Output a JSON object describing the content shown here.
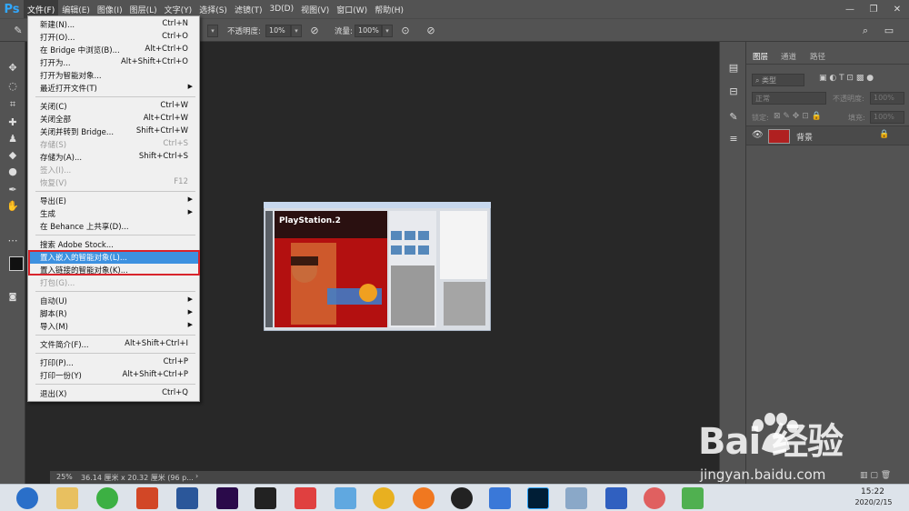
{
  "app": {
    "logo": "Ps"
  },
  "menubar": {
    "items": [
      "文件(F)",
      "编辑(E)",
      "图像(I)",
      "图层(L)",
      "文字(Y)",
      "选择(S)",
      "滤镜(T)",
      "3D(D)",
      "视图(V)",
      "窗口(W)",
      "帮助(H)"
    ]
  },
  "window_controls": {
    "minimize": "—",
    "restore": "❐",
    "close": "✕"
  },
  "options_bar": {
    "opacity_label": "不透明度:",
    "opacity_value": "10%",
    "flow_label": "流量:",
    "flow_value": "100%"
  },
  "file_menu": {
    "items": [
      {
        "label": "新建(N)...",
        "shortcut": "Ctrl+N"
      },
      {
        "label": "打开(O)...",
        "shortcut": "Ctrl+O"
      },
      {
        "label": "在 Bridge 中浏览(B)...",
        "shortcut": "Alt+Ctrl+O"
      },
      {
        "label": "打开为...",
        "shortcut": "Alt+Shift+Ctrl+O"
      },
      {
        "label": "打开为智能对象...",
        "shortcut": ""
      },
      {
        "label": "最近打开文件(T)",
        "shortcut": ""
      },
      {
        "label": "关闭(C)",
        "shortcut": "Ctrl+W"
      },
      {
        "label": "关闭全部",
        "shortcut": "Alt+Ctrl+W"
      },
      {
        "label": "关闭并转到 Bridge...",
        "shortcut": "Shift+Ctrl+W"
      },
      {
        "label": "存储(S)",
        "shortcut": "Ctrl+S"
      },
      {
        "label": "存储为(A)...",
        "shortcut": "Shift+Ctrl+S"
      },
      {
        "label": "签入(I)...",
        "shortcut": ""
      },
      {
        "label": "恢复(V)",
        "shortcut": "F12"
      },
      {
        "label": "导出(E)",
        "shortcut": ""
      },
      {
        "label": "生成",
        "shortcut": ""
      },
      {
        "label": "在 Behance 上共享(D)...",
        "shortcut": ""
      },
      {
        "label": "搜索 Adobe Stock...",
        "shortcut": ""
      },
      {
        "label": "置入嵌入的智能对象(L)...",
        "shortcut": ""
      },
      {
        "label": "置入链接的智能对象(K)...",
        "shortcut": ""
      },
      {
        "label": "打包(G)...",
        "shortcut": ""
      },
      {
        "label": "自动(U)",
        "shortcut": ""
      },
      {
        "label": "脚本(R)",
        "shortcut": ""
      },
      {
        "label": "导入(M)",
        "shortcut": ""
      },
      {
        "label": "文件简介(F)...",
        "shortcut": "Alt+Shift+Ctrl+I"
      },
      {
        "label": "打印(P)...",
        "shortcut": "Ctrl+P"
      },
      {
        "label": "打印一份(Y)",
        "shortcut": "Alt+Shift+Ctrl+P"
      },
      {
        "label": "退出(X)",
        "shortcut": "Ctrl+Q"
      }
    ]
  },
  "layers_panel": {
    "tabs": [
      "图层",
      "通道",
      "路径"
    ],
    "filter_placeholder": "类型",
    "blend_mode": "正常",
    "opacity_label": "不透明度:",
    "opacity_value": "100%",
    "lock_label": "锁定:",
    "fill_label": "填充:",
    "fill_value": "100%",
    "layer_name": "背景"
  },
  "status": {
    "zoom": "25%",
    "doc_info": "36.14 厘米 x 20.32 厘米 (96 p...",
    "more": "›"
  },
  "canvas_content": {
    "ps2_logo": "PlayStation.2"
  },
  "taskbar": {
    "time": "15:22",
    "date": "2020/2/15"
  },
  "watermark": {
    "logo": "Bai  经验",
    "url": "jingyan.baidu.com"
  }
}
